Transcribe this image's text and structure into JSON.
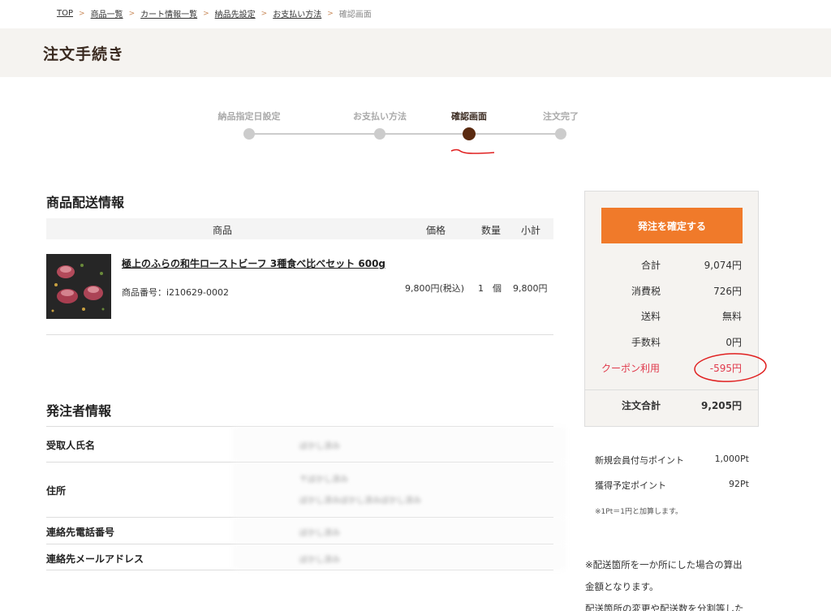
{
  "breadcrumb": {
    "items": [
      "TOP",
      "商品一覧",
      "カート情報一覧",
      "納品先設定",
      "お支払い方法"
    ],
    "current": "確認画面",
    "separator": ">"
  },
  "page_title": "注文手続き",
  "steps": [
    {
      "label": "納品指定日設定",
      "active": false
    },
    {
      "label": "お支払い方法",
      "active": false
    },
    {
      "label": "確認画面",
      "active": true
    },
    {
      "label": "注文完了",
      "active": false
    }
  ],
  "shipping_section": {
    "title": "商品配送情報",
    "columns": {
      "product": "商品",
      "price": "価格",
      "qty": "数量",
      "subtotal": "小計"
    },
    "item": {
      "name": "極上のふらの和牛ローストビーフ 3種食べ比べセット 600g",
      "sku": "商品番号：i210629-0002",
      "price": "9,800円(税込)",
      "qty": "1　個",
      "subtotal": "9,800円"
    }
  },
  "orderer_section": {
    "title": "発注者情報",
    "rows": [
      {
        "label": "受取人氏名",
        "lines": [
          "ぼかし済み"
        ]
      },
      {
        "label": "住所",
        "lines": [
          "〒ぼかし済み",
          "ぼかし済みぼかし済みぼかし済み"
        ]
      },
      {
        "label": "連絡先電話番号",
        "lines": [
          "ぼかし済み"
        ]
      },
      {
        "label": "連絡先メールアドレス",
        "lines": [
          "ぼかし済み"
        ]
      }
    ]
  },
  "summary": {
    "confirm_button": "発注を確定する",
    "rows": [
      {
        "label": "合計",
        "value": "9,074円"
      },
      {
        "label": "消費税",
        "value": "726円"
      },
      {
        "label": "送料",
        "value": "無料"
      },
      {
        "label": "手数料",
        "value": "0円"
      }
    ],
    "coupon": {
      "label": "クーポン利用",
      "value": "-595円"
    },
    "total": {
      "label": "注文合計",
      "value": "9,205円"
    }
  },
  "points": {
    "rows": [
      {
        "label": "新規会員付与ポイント",
        "value": "1,000Pt"
      },
      {
        "label": "獲得予定ポイント",
        "value": "92Pt"
      }
    ],
    "note": "※1Pt＝1円と加算します。"
  },
  "notice": {
    "line1": "※配送箇所を一か所にした場合の算出",
    "line2": "金額となります。",
    "line3": "配送箇所の変更や配送数を分割等した"
  },
  "colors": {
    "accent": "#f07a2a",
    "coupon_red": "#e0394b",
    "active_step": "#5a2a10",
    "header_bg": "#f5f3f0"
  }
}
